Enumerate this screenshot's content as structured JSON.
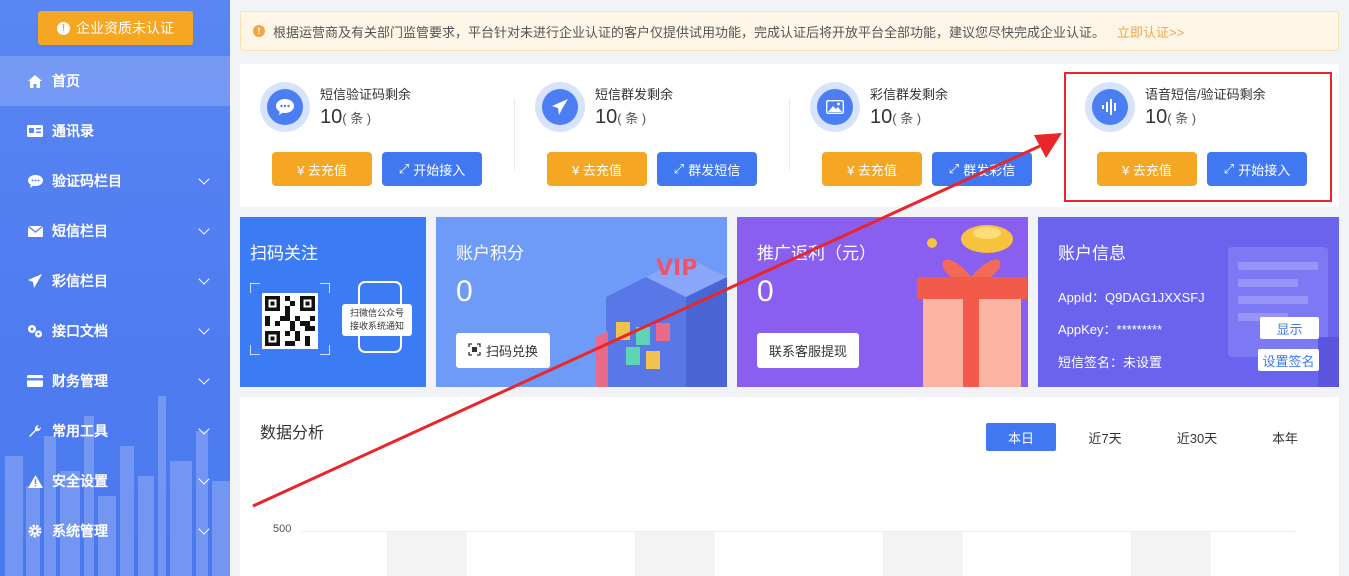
{
  "sidebar": {
    "cert_button": "企业资质未认证",
    "items": [
      {
        "label": "首页",
        "icon": "home-icon",
        "active": true,
        "expandable": false
      },
      {
        "label": "通讯录",
        "icon": "contacts-icon",
        "active": false,
        "expandable": false
      },
      {
        "label": "验证码栏目",
        "icon": "chat-icon",
        "active": false,
        "expandable": true
      },
      {
        "label": "短信栏目",
        "icon": "mail-icon",
        "active": false,
        "expandable": true
      },
      {
        "label": "彩信栏目",
        "icon": "send-icon",
        "active": false,
        "expandable": true
      },
      {
        "label": "接口文档",
        "icon": "api-icon",
        "active": false,
        "expandable": true
      },
      {
        "label": "财务管理",
        "icon": "card-icon",
        "active": false,
        "expandable": true
      },
      {
        "label": "常用工具",
        "icon": "wrench-icon",
        "active": false,
        "expandable": true
      },
      {
        "label": "安全设置",
        "icon": "warning-icon",
        "active": false,
        "expandable": true
      },
      {
        "label": "系统管理",
        "icon": "gear-icon",
        "active": false,
        "expandable": true
      }
    ]
  },
  "notice": {
    "text": "根据运营商及有关部门监管要求，平台针对未进行企业认证的客户仅提供试用功能，完成认证后将开放平台全部功能，建议您尽快完成企业认证。",
    "link": "立即认证>>"
  },
  "stats": [
    {
      "label": "短信验证码剩余",
      "value": "10",
      "unit": "( 条 )",
      "icon": "chat-bubble-icon",
      "recharge": "¥ 去充值",
      "action": "开始接入"
    },
    {
      "label": "短信群发剩余",
      "value": "10",
      "unit": "( 条 )",
      "icon": "paper-plane-icon",
      "recharge": "¥ 去充值",
      "action": "群发短信"
    },
    {
      "label": "彩信群发剩余",
      "value": "10",
      "unit": "( 条 )",
      "icon": "image-icon",
      "recharge": "¥ 去充值",
      "action": "群发彩信"
    },
    {
      "label": "语音短信/验证码剩余",
      "value": "10",
      "unit": "( 条 )",
      "icon": "voice-wave-icon",
      "recharge": "¥ 去充值",
      "action": "开始接入"
    }
  ],
  "banners": {
    "scan": {
      "title": "扫码关注",
      "caption_line1": "扫微信公众号",
      "caption_line2": "接收系统通知"
    },
    "points": {
      "title": "账户积分",
      "value": "0",
      "button": "扫码兑换"
    },
    "rebate": {
      "title": "推广返利（元）",
      "value": "0",
      "button": "联系客服提现"
    },
    "account": {
      "title": "账户信息",
      "appid_label": "AppId：",
      "appid": "Q9DAG1JXXSFJ",
      "appkey_label": "AppKey：",
      "appkey": "*********",
      "show_button": "显示",
      "sign_label": "短信签名：",
      "sign": "未设置",
      "sign_button": "设置签名"
    }
  },
  "analysis": {
    "title": "数据分析",
    "tabs": [
      {
        "label": "本日",
        "active": true
      },
      {
        "label": "近7天",
        "active": false
      },
      {
        "label": "近30天",
        "active": false
      },
      {
        "label": "本年",
        "active": false
      }
    ],
    "y_tick": "500"
  },
  "colors": {
    "primary": "#3f78f0",
    "orange": "#f5a623",
    "highlight": "#e8262b"
  }
}
